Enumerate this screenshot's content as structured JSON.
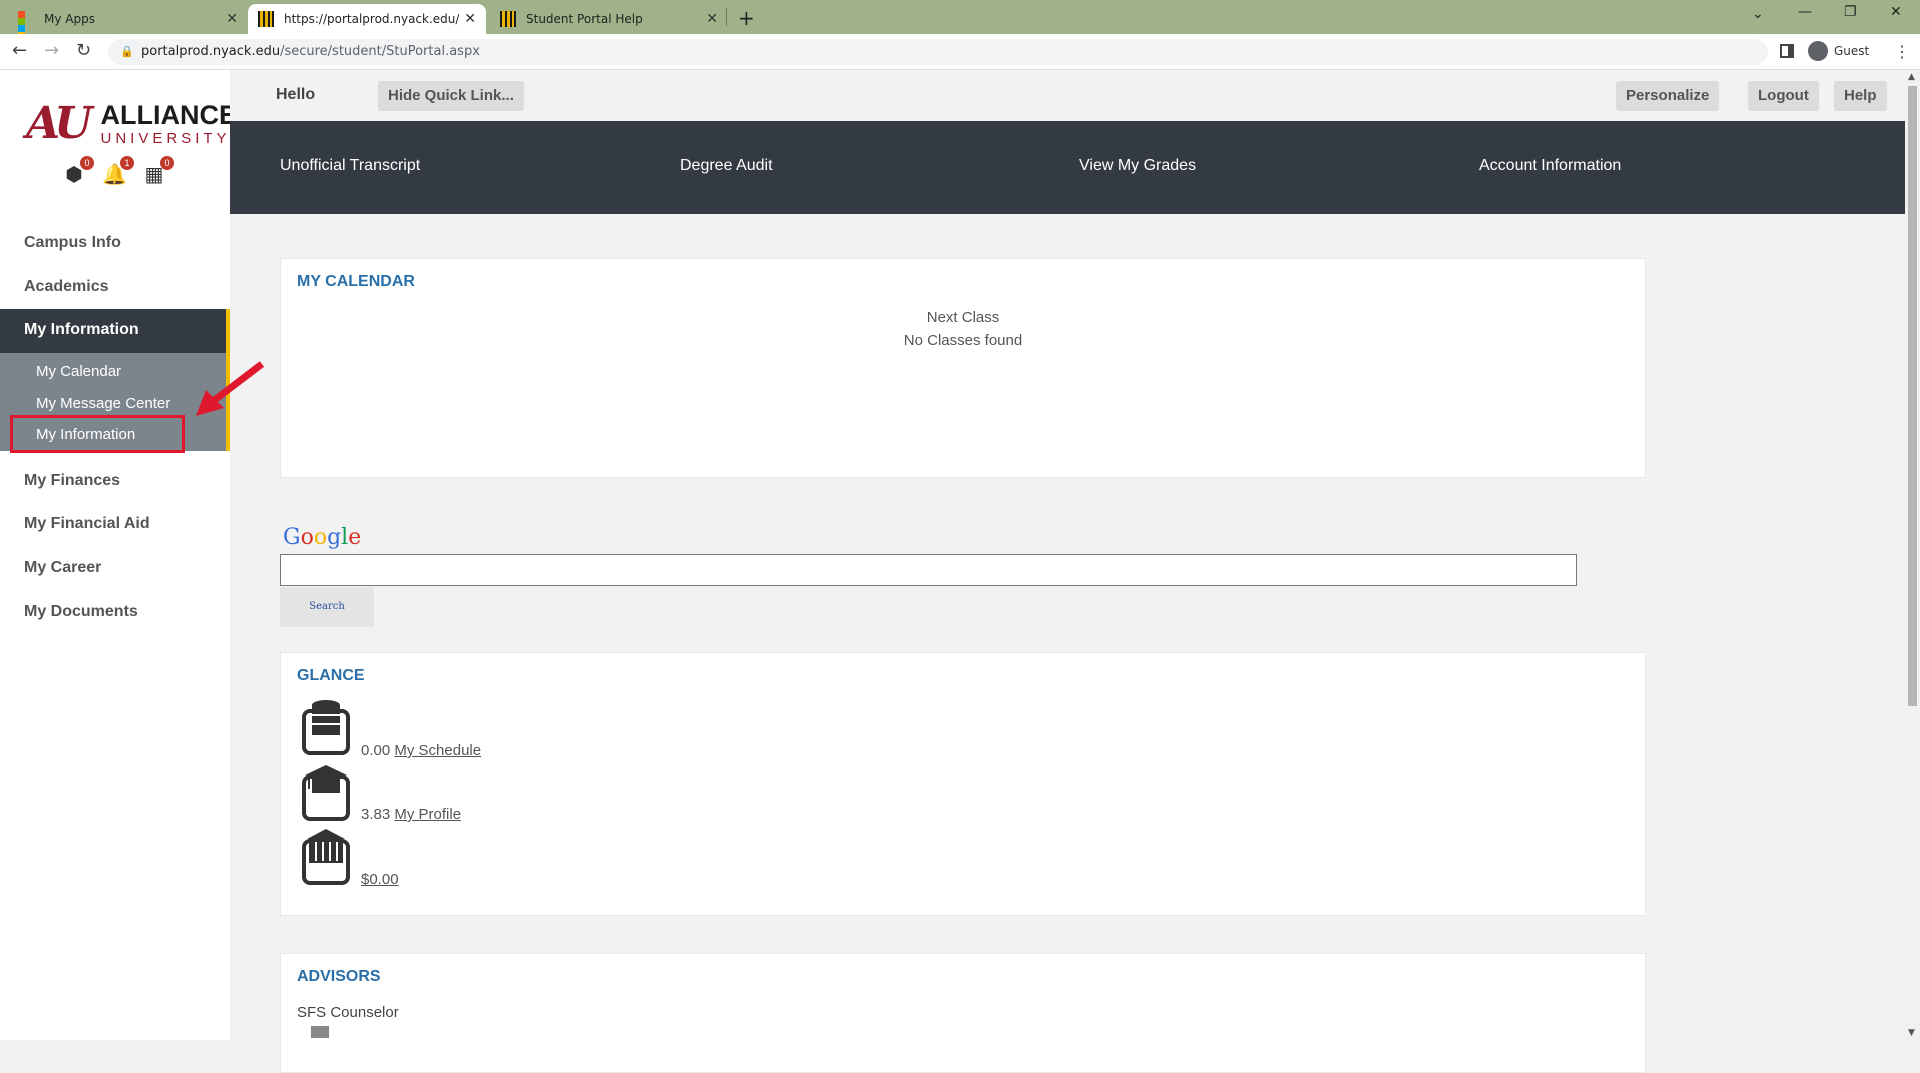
{
  "browser": {
    "tabs": [
      {
        "title": "My Apps"
      },
      {
        "title": "https://portalprod.nyack.edu/sec"
      },
      {
        "title": "Student Portal Help"
      }
    ],
    "url_host": "portalprod.nyack.edu",
    "url_path": "/secure/student/StuPortal.aspx",
    "profile_label": "Guest"
  },
  "logo": {
    "mark": "AU",
    "line1": "ALLIANCE",
    "line2": "UNIVERSITY"
  },
  "badges": [
    {
      "icon": "alert-icon",
      "count": "0"
    },
    {
      "icon": "bell-icon",
      "count": "1"
    },
    {
      "icon": "calendar-icon",
      "count": "0"
    }
  ],
  "sidebar": {
    "items": [
      "Campus Info",
      "Academics",
      "My Information",
      "My Finances",
      "My Financial Aid",
      "My Career",
      "My Documents"
    ],
    "active": "My Information",
    "submenu": [
      "My Calendar",
      "My Message Center",
      "My Information"
    ]
  },
  "topbar": {
    "hello": "Hello",
    "hide_quick": "Hide Quick Link...",
    "personalize": "Personalize",
    "logout": "Logout",
    "help": "Help"
  },
  "quicklinks": [
    "Unofficial Transcript",
    "Degree Audit",
    "View My Grades",
    "Account Information"
  ],
  "calendar": {
    "title": "MY CALENDAR",
    "next_class": "Next Class",
    "no_classes": "No Classes found"
  },
  "google": {
    "search_label": "Search"
  },
  "glance": {
    "title": "GLANCE",
    "rows": [
      {
        "value": "0.00",
        "link": "My Schedule",
        "icon": "schedule-icon"
      },
      {
        "value": "3.83",
        "link": "My Profile",
        "icon": "profile-icon"
      },
      {
        "value": "",
        "link": "$0.00",
        "icon": "bank-icon"
      }
    ]
  },
  "advisors": {
    "title": "ADVISORS",
    "counselor": "SFS Counselor"
  },
  "colors": {
    "accent": "#2a6fa8",
    "dark": "#333a41",
    "highlight": "#e0182d",
    "gold": "#f0c000"
  }
}
